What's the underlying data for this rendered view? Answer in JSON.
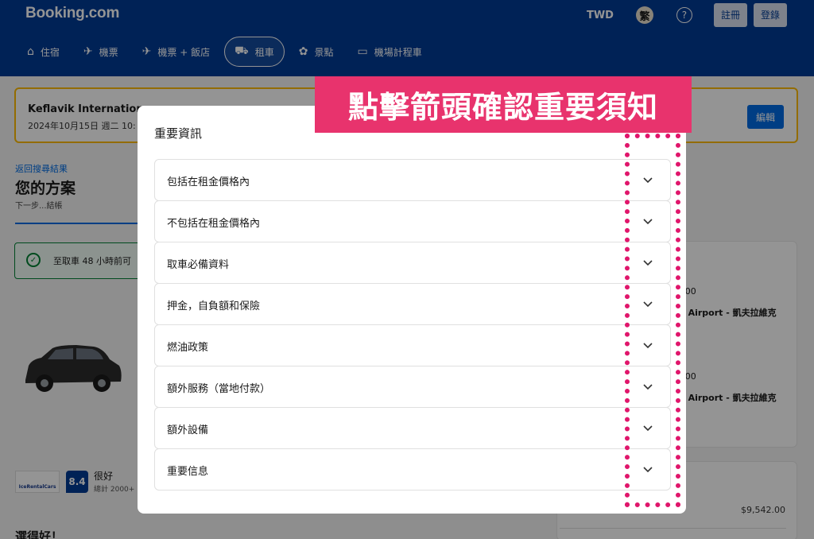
{
  "header": {
    "logo": "Booking.com",
    "currency": "TWD",
    "language": "繁",
    "help": "?",
    "register": "註冊",
    "login": "登錄",
    "nav": [
      {
        "icon": "bed-icon",
        "glyph": "🛏",
        "label": "住宿",
        "active": false
      },
      {
        "icon": "plane-icon",
        "glyph": "✈",
        "label": "機票",
        "active": false
      },
      {
        "icon": "plane-hotel-icon",
        "glyph": "✈",
        "label": "機票 + 飯店",
        "active": false
      },
      {
        "icon": "car-icon",
        "glyph": "🚗",
        "label": "租車",
        "active": true
      },
      {
        "icon": "attraction-icon",
        "glyph": "✿",
        "label": "景點",
        "active": false
      },
      {
        "icon": "taxi-icon",
        "glyph": "🚕",
        "label": "機場計程車",
        "active": false
      }
    ]
  },
  "summary": {
    "location": "Keflavik Internationa",
    "date": "2024年10月15日 週二 10:",
    "edit": "編輯"
  },
  "plan": {
    "back": "返回搜尋結果",
    "title": "您的方案",
    "subtitle": "下一步...結帳",
    "notice": "至取車 48 小時前可"
  },
  "supplier": {
    "logo_text": "IceRentalCars",
    "score": "8.4",
    "score_word": "很好",
    "review_count": "總計 2000+"
  },
  "bottom_title": "選得好！",
  "side": {
    "time1": ":00",
    "airport1": "l Airport - 凱夫拉維克",
    "time2": ":00",
    "airport2": "l Airport - 凱夫拉維克",
    "price": "$9,542.00"
  },
  "modal": {
    "title": "重要資訊",
    "close": "×",
    "items": [
      "包括在租金價格內",
      "不包括在租金價格內",
      "取車必備資料",
      "押金，自負額和保險",
      "燃油政策",
      "額外服務（當地付款）",
      "額外設備",
      "重要信息"
    ]
  },
  "annotation": {
    "banner": "點擊箭頭確認重要須知",
    "banner_color": "#e8336d",
    "dot_color": "#e0166b"
  }
}
